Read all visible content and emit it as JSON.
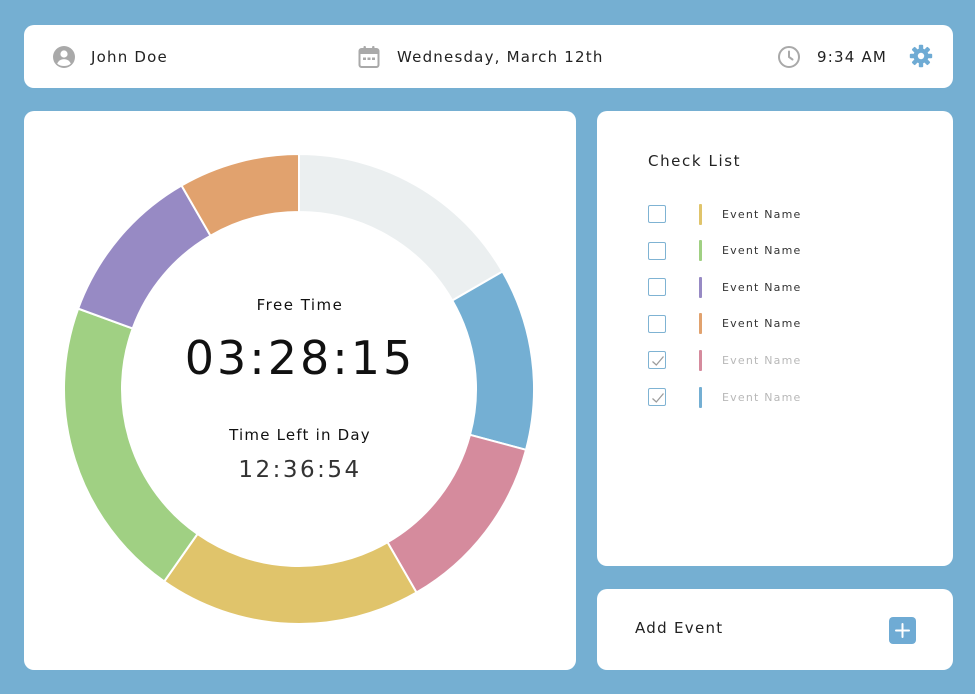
{
  "header": {
    "user_name": "John Doe",
    "date": "Wednesday, March 12th",
    "time": "9:34 AM"
  },
  "timer": {
    "free_label": "Free Time",
    "free_value": "03:28:15",
    "left_label": "Time Left in Day",
    "left_value": "12:36:54"
  },
  "ring": {
    "segments": [
      {
        "name": "free",
        "color": "#ebeff0",
        "start_deg": 0,
        "end_deg": 60
      },
      {
        "name": "blue",
        "color": "#74afd3",
        "start_deg": 60,
        "end_deg": 105
      },
      {
        "name": "pink",
        "color": "#d58b9d",
        "start_deg": 105,
        "end_deg": 150
      },
      {
        "name": "yellow",
        "color": "#e0c46b",
        "start_deg": 150,
        "end_deg": 215
      },
      {
        "name": "green",
        "color": "#a0d083",
        "start_deg": 215,
        "end_deg": 290
      },
      {
        "name": "purple",
        "color": "#978ac4",
        "start_deg": 290,
        "end_deg": 330
      },
      {
        "name": "orange",
        "color": "#e1a26e",
        "start_deg": 330,
        "end_deg": 360
      }
    ]
  },
  "checklist": {
    "title": "Check List",
    "items": [
      {
        "label": "Event Name",
        "color": "#e0c46b",
        "checked": false
      },
      {
        "label": "Event Name",
        "color": "#a0d083",
        "checked": false
      },
      {
        "label": "Event Name",
        "color": "#978ac4",
        "checked": false
      },
      {
        "label": "Event Name",
        "color": "#e1a26e",
        "checked": false
      },
      {
        "label": "Event Name",
        "color": "#d58b9d",
        "checked": true
      },
      {
        "label": "Event Name",
        "color": "#74afd3",
        "checked": true
      }
    ]
  },
  "add_event": {
    "label": "Add Event"
  },
  "icons": {
    "user": "user-circle-icon",
    "calendar": "calendar-icon",
    "clock": "clock-icon",
    "settings": "gear-icon",
    "add": "plus-icon",
    "check": "check-icon"
  },
  "colors": {
    "background": "#75afd2",
    "accent": "#6fabd4"
  }
}
